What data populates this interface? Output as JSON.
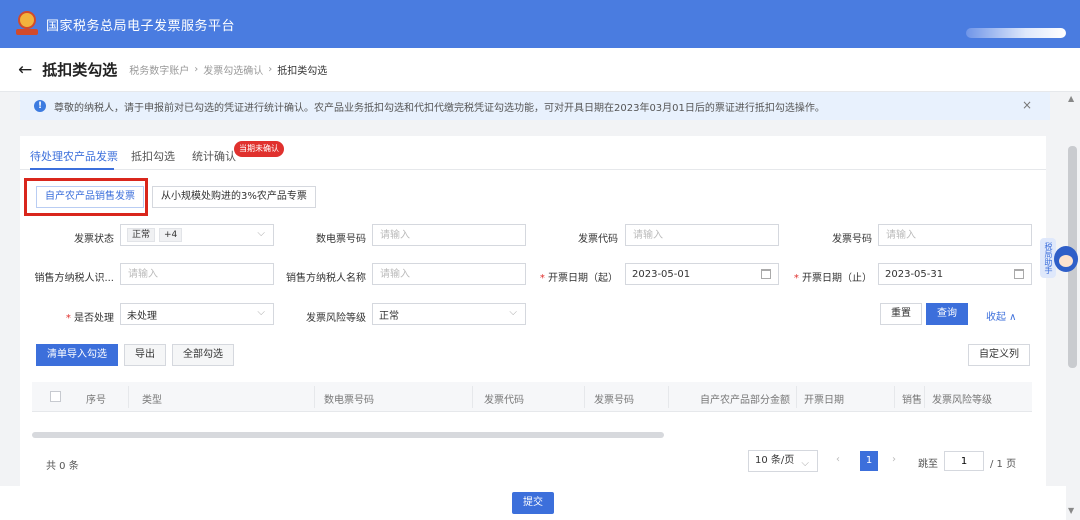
{
  "header": {
    "app_title": "国家税务总局电子发票服务平台"
  },
  "breadcrumb": {
    "page_title": "抵扣类勾选",
    "items": [
      "税务数字账户",
      "发票勾选确认",
      "抵扣类勾选"
    ],
    "separator": "›"
  },
  "notice": {
    "text": "尊敬的纳税人，请于申报前对已勾选的凭证进行统计确认。农产品业务抵扣勾选和代扣代缴完税凭证勾选功能，可对开具日期在2023年03月01日后的票证进行抵扣勾选操作。",
    "close": "×"
  },
  "tabs": [
    {
      "label": "待处理农产品发票",
      "active": true
    },
    {
      "label": "抵扣勾选",
      "active": false
    },
    {
      "label": "统计确认",
      "active": false,
      "badge": "当期未确认"
    }
  ],
  "subtabs": [
    {
      "label": "自产农产品销售发票",
      "active": true
    },
    {
      "label": "从小规模处购进的3%农产品专票",
      "active": false
    }
  ],
  "filters": {
    "invoice_status": {
      "label": "发票状态",
      "tag": "正常",
      "more": "+4"
    },
    "digital_invoice_no": {
      "label": "数电票号码",
      "placeholder": "请输入"
    },
    "invoice_code": {
      "label": "发票代码",
      "placeholder": "请输入"
    },
    "invoice_no": {
      "label": "发票号码",
      "placeholder": "请输入"
    },
    "seller_tax_id": {
      "label": "销售方纳税人识...",
      "placeholder": "请输入"
    },
    "seller_name": {
      "label": "销售方纳税人名称",
      "placeholder": "请输入"
    },
    "start_date": {
      "label": "开票日期（起）",
      "value": "2023-05-01"
    },
    "end_date": {
      "label": "开票日期（止）",
      "value": "2023-05-31"
    },
    "processed": {
      "label": "是否处理",
      "value": "未处理"
    },
    "risk_level": {
      "label": "发票风险等级",
      "value": "正常"
    },
    "required_mark": "*"
  },
  "actions": {
    "reset": "重置",
    "query": "查询",
    "collapse": "收起 ∧"
  },
  "toolbar": {
    "import_select": "清单导入勾选",
    "export": "导出",
    "select_all": "全部勾选",
    "custom_columns": "自定义列"
  },
  "table": {
    "columns": [
      "序号",
      "类型",
      "数电票号码",
      "发票代码",
      "发票号码",
      "自产农产品部分金额",
      "开票日期",
      "销售",
      "发票风险等级"
    ],
    "rows": []
  },
  "pagination": {
    "total": "共 0 条",
    "page_size": "10 条/页",
    "prev": "‹",
    "current_page": "1",
    "next": "›",
    "jump_label": "跳至",
    "jump_value": "1",
    "page_total": "/ 1 页"
  },
  "footer": {
    "submit": "提交"
  },
  "assistant": {
    "label": "税局助手"
  },
  "colors": {
    "header_blue": "#4a7ce0",
    "primary": "#3c6fdb",
    "badge_red": "#e0312e",
    "highlight_red": "#d9261c"
  }
}
